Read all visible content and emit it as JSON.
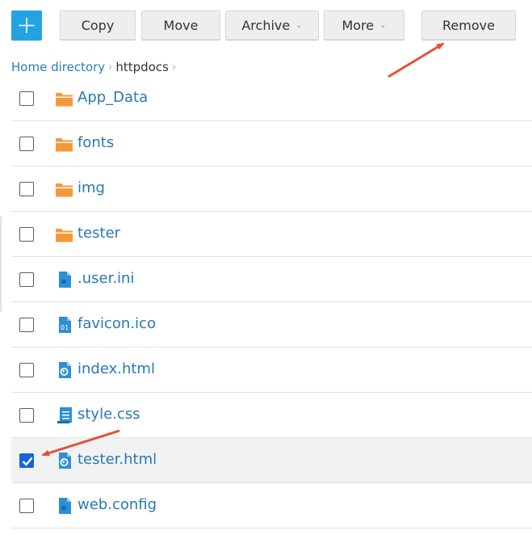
{
  "toolbar": {
    "add_label": "+",
    "copy_label": "Copy",
    "move_label": "Move",
    "archive_label": "Archive",
    "more_label": "More",
    "remove_label": "Remove",
    "caret": "⌄"
  },
  "breadcrumb": {
    "home": "Home directory",
    "current": "httpdocs",
    "separator": "›"
  },
  "files": [
    {
      "name": "App_Data",
      "icon": "folder-icon",
      "checked": false
    },
    {
      "name": "fonts",
      "icon": "folder-icon",
      "checked": false
    },
    {
      "name": "img",
      "icon": "folder-icon",
      "checked": false
    },
    {
      "name": "tester",
      "icon": "folder-icon",
      "checked": false
    },
    {
      "name": ".user.ini",
      "icon": "file-icon",
      "checked": false
    },
    {
      "name": "favicon.ico",
      "icon": "binary-file-icon",
      "checked": false
    },
    {
      "name": "index.html",
      "icon": "web-file-icon",
      "checked": false
    },
    {
      "name": "style.css",
      "icon": "stylesheet-file-icon",
      "checked": false
    },
    {
      "name": "tester.html",
      "icon": "web-file-icon",
      "checked": true
    },
    {
      "name": "web.config",
      "icon": "file-icon",
      "checked": false
    }
  ],
  "colors": {
    "accent": "#24a3e2",
    "link": "#2779b8",
    "folder": "#f39a38",
    "file": "#2d8fd8",
    "checkbox_checked": "#1565e0",
    "annotation_arrow": "#e0533a"
  }
}
